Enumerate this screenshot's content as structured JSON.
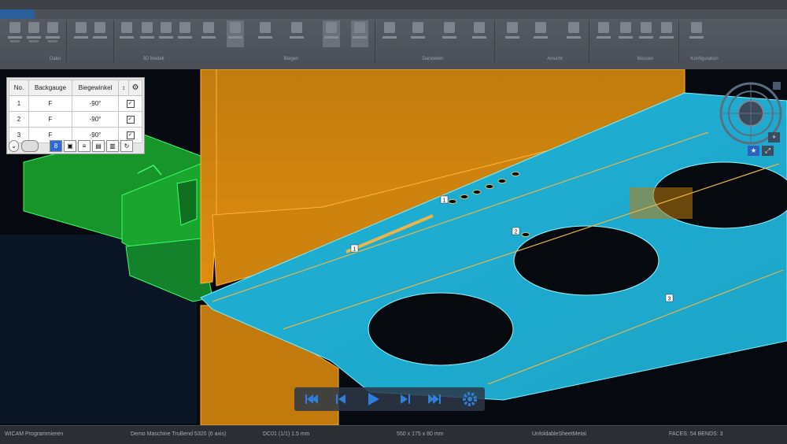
{
  "ribbon": {
    "groups": [
      "Datei",
      "3D Modell",
      "Biegen",
      "Darstellen",
      "Ansicht",
      "Messen",
      "Konfiguration"
    ]
  },
  "bend_table": {
    "headers": {
      "no": "No.",
      "backgauge": "Backgauge",
      "angle": "Biegewinkel",
      "sort": "↕"
    },
    "rows": [
      {
        "no": "1",
        "backgauge": "F",
        "angle": "-90°",
        "checked": "✓"
      },
      {
        "no": "2",
        "backgauge": "F",
        "angle": "-90°",
        "checked": "✓"
      },
      {
        "no": "3",
        "backgauge": "F",
        "angle": "-90°",
        "checked": "✓"
      }
    ],
    "toolbar": {
      "bend_count": "8"
    }
  },
  "scene": {
    "bend_labels": [
      "1",
      "1",
      "2",
      "3"
    ],
    "colors": {
      "punch": "#d88a10",
      "die": "#1ba52e",
      "sheet": "#22b8dc",
      "bend_line": "#e9b54a",
      "viewport_bg": "#060a10"
    }
  },
  "playback": {
    "icons": [
      "skip-to-start-icon",
      "step-back-icon",
      "play-icon",
      "step-forward-icon",
      "skip-to-end-icon",
      "gear-icon"
    ]
  },
  "status_bar": {
    "app": "WICAM Programmieren",
    "machine": "Demo Maschine TruBend 5320 (6 axis)",
    "bend_info": "DC01   (1/1)   1.5 mm",
    "dimensions": "550 x 175 x 80 mm",
    "state": "UnfoldableSheetMetal",
    "counts": "FACES: 54    BENDS: 3"
  }
}
